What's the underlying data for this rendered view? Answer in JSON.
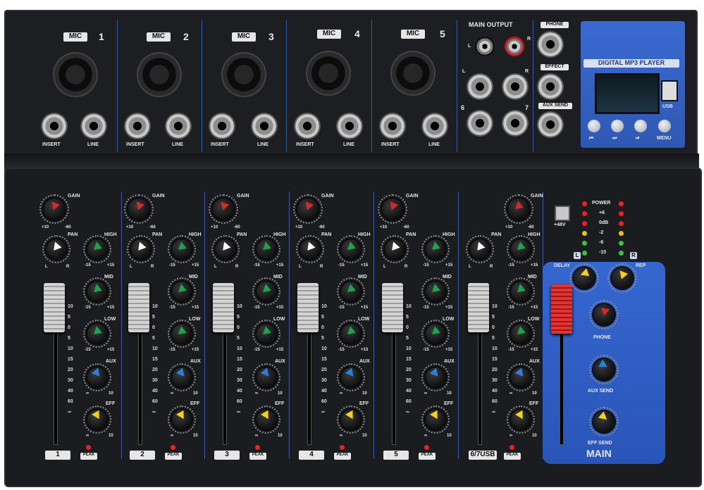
{
  "top_panel": {
    "mic_channels": [
      {
        "tag": "MIC",
        "number": "1",
        "insert": "INSERT",
        "line": "LINE"
      },
      {
        "tag": "MIC",
        "number": "2",
        "insert": "INSERT",
        "line": "LINE"
      },
      {
        "tag": "MIC",
        "number": "3",
        "insert": "INSERT",
        "line": "LINE"
      },
      {
        "tag": "MIC",
        "number": "4",
        "insert": "INSERT",
        "line": "LINE"
      },
      {
        "tag": "MIC",
        "number": "5",
        "insert": "INSERT",
        "line": "LINE"
      }
    ],
    "main_output": {
      "title": "MAIN OUTPUT",
      "left": "L",
      "right": "R",
      "left2": "L",
      "right2": "R",
      "ch6": "6",
      "ch7": "7"
    },
    "phone": "PHONE",
    "effect": "EFFECT",
    "aux_send": "AUX SEND",
    "mp3": {
      "title": "DIGITAL MP3 PLAYER",
      "usb": "USB",
      "prev": "⏮",
      "next": "⏭",
      "play": "⏯",
      "menu": "MENU"
    }
  },
  "channel_strip": {
    "gain": "GAIN",
    "pan": "PAN",
    "high": "HIGH",
    "mid": "MID",
    "low": "LOW",
    "aux": "AUX",
    "eff": "EFF",
    "peak": "PEAK",
    "gain_min": "+10",
    "gain_max": "-60",
    "pan_l": "L",
    "pan_r": "R",
    "eq_min": "-15",
    "eq_max": "+15",
    "send_min": "∞",
    "send_max": "10",
    "fader_scale": [
      "10",
      "5",
      "0",
      "5",
      "10",
      "15",
      "20",
      "30",
      "40",
      "60",
      "∞"
    ],
    "channels": [
      "1",
      "2",
      "3",
      "4",
      "5",
      "6/7USB"
    ]
  },
  "meter": {
    "power": "POWER",
    "phantom": "+48V",
    "levels": [
      "+6",
      "0dB",
      "-2",
      "-6",
      "-10"
    ],
    "left": "L",
    "right": "R"
  },
  "main_section": {
    "delay": "DELAY",
    "rep": "REP",
    "phone": "PHONE",
    "aux_send": "AUX SEND",
    "eff_send": "EFF SEND",
    "main": "MAIN"
  },
  "colors": {
    "body": "#1a1c20",
    "accent_blue": "#2f5fc4",
    "gain_knob": "#d12a2a",
    "eq_knob": "#1ea34a",
    "aux_knob": "#2d7fd6",
    "eff_knob": "#f2d21a",
    "main_fader": "#c81f1f"
  }
}
